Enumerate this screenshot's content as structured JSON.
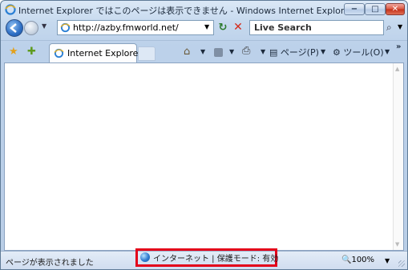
{
  "window": {
    "title": "Internet Explorer ではこのページは表示できません - Windows Internet Explor",
    "minimize_label": "−",
    "maximize_label": "□",
    "close_label": "✕"
  },
  "address_bar": {
    "url": "http://azby.fmworld.net/"
  },
  "search": {
    "placeholder": "Live Search",
    "go_icon": "⌕"
  },
  "tab": {
    "label": "Internet Explorer"
  },
  "toolbar": {
    "page_label": "ページ(P)",
    "tools_label": "ツール(O)"
  },
  "status_bar": {
    "message": "ページが表示されました",
    "zone": "インターネット | 保護モード: 有効",
    "zoom": "🔍100%"
  },
  "colors": {
    "highlight_border": "#e3001a",
    "chrome_accent": "#bcd1ea"
  }
}
